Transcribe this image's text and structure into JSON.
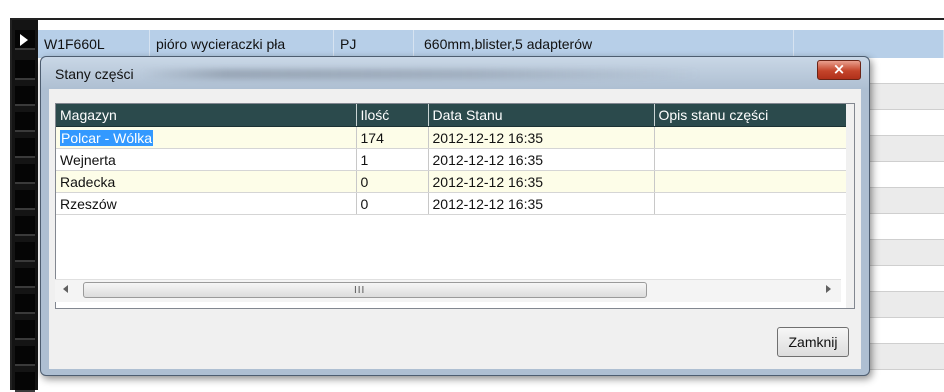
{
  "background_grid": {
    "selected_row": {
      "code": "W1F660L",
      "name": "pióro wycieraczki pła",
      "unit": "PJ",
      "description": "660mm,blister,5 adapterów"
    }
  },
  "dialog": {
    "title": "Stany części",
    "close_icon": "×",
    "table": {
      "columns": [
        "Magazyn",
        "Ilość",
        "Data Stanu",
        "Opis stanu części"
      ],
      "rows": [
        {
          "magazyn": "Polcar - Wólka",
          "ilosc": "174",
          "data": "2012-12-12 16:35",
          "opis": ""
        },
        {
          "magazyn": "Wejnerta",
          "ilosc": "1",
          "data": "2012-12-12 16:35",
          "opis": ""
        },
        {
          "magazyn": "Radecka",
          "ilosc": "0",
          "data": "2012-12-12 16:35",
          "opis": ""
        },
        {
          "magazyn": "Rzeszów",
          "ilosc": "0",
          "data": "2012-12-12 16:35",
          "opis": ""
        }
      ]
    },
    "scrollbar_grip": "III",
    "close_button_label": "Zamknij"
  },
  "colors": {
    "header_bg": "#2b4a4c",
    "selection": "#3399ff",
    "selected_row_bg": "#b7cfe8",
    "close_btn": "#c4442a"
  }
}
